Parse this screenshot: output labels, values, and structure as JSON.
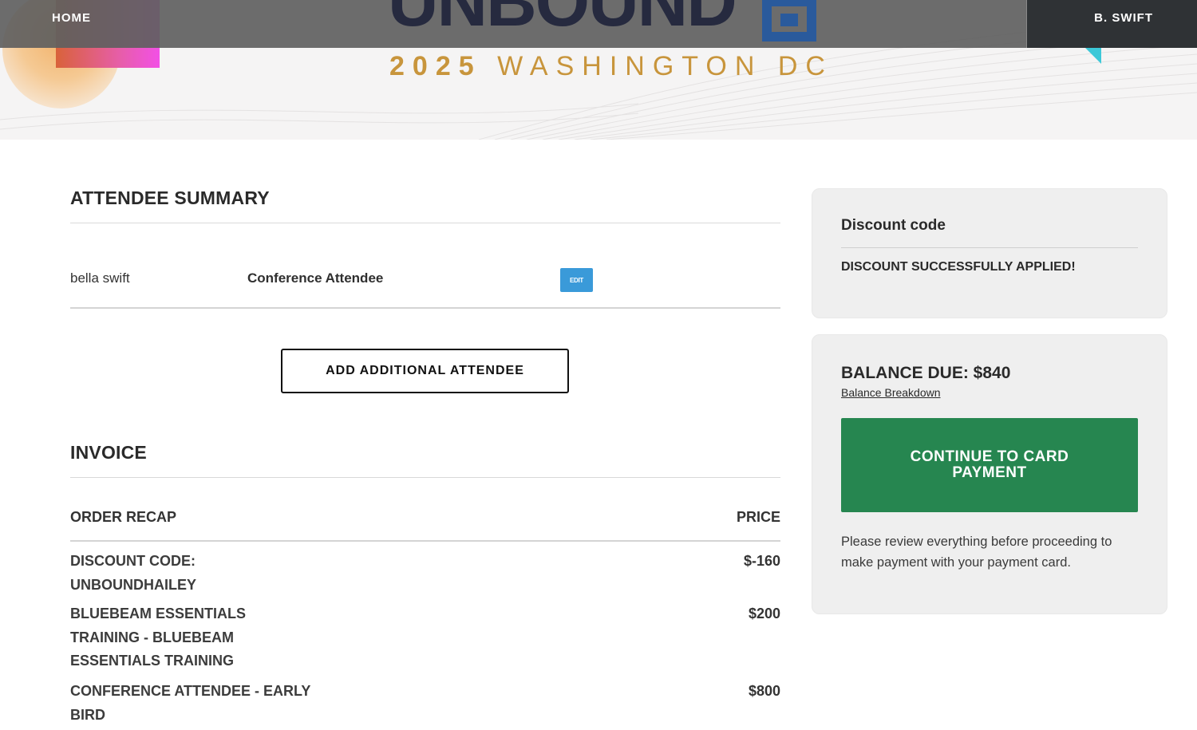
{
  "nav": {
    "home_label": "HOME",
    "user_label": "B. SWIFT"
  },
  "hero": {
    "logo_text": "UNBOUND",
    "year": "2025",
    "location": "WASHINGTON DC",
    "colors": {
      "navy": "#262a3f",
      "gold": "#c8953c",
      "blue": "#2a5a9c",
      "teal": "#3cc8d8"
    }
  },
  "attendee_summary": {
    "title": "ATTENDEE SUMMARY",
    "attendees": [
      {
        "name": "bella swift",
        "type": "Conference Attendee",
        "edit_label": "EDIT"
      }
    ],
    "add_button_label": "ADD ADDITIONAL ATTENDEE"
  },
  "invoice": {
    "title": "INVOICE",
    "col_recap": "ORDER RECAP",
    "col_price": "PRICE",
    "rows": [
      {
        "label": "DISCOUNT CODE: UNBOUNDHAILEY",
        "price": "$-160"
      },
      {
        "label": "BLUEBEAM ESSENTIALS TRAINING - BLUEBEAM ESSENTIALS TRAINING",
        "price": "$200"
      },
      {
        "label": "CONFERENCE ATTENDEE - EARLY BIRD",
        "price": "$800"
      }
    ]
  },
  "discount": {
    "title": "Discount code",
    "status": "DISCOUNT SUCCESSFULLY APPLIED!"
  },
  "balance": {
    "title": "BALANCE DUE: $840",
    "breakdown_link": "Balance Breakdown",
    "pay_button": "CONTINUE TO CARD PAYMENT",
    "note": "Please review everything before proceeding to make payment with your payment card.",
    "button_color": "#268650"
  }
}
